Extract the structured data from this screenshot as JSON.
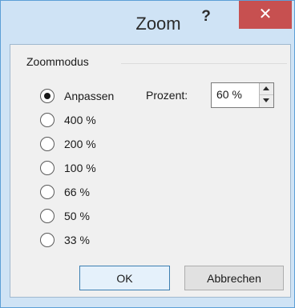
{
  "window": {
    "title": "Zoom",
    "help_label": "?",
    "close_label": "✕"
  },
  "group": {
    "label": "Zoommodus"
  },
  "options": [
    {
      "label": "Anpassen",
      "selected": true
    },
    {
      "label": "400 %",
      "selected": false
    },
    {
      "label": "200 %",
      "selected": false
    },
    {
      "label": "100 %",
      "selected": false
    },
    {
      "label": "66 %",
      "selected": false
    },
    {
      "label": "50 %",
      "selected": false
    },
    {
      "label": "33 %",
      "selected": false
    }
  ],
  "percent": {
    "label": "Prozent:",
    "value": "60 %"
  },
  "buttons": {
    "ok": "OK",
    "cancel": "Abbrechen"
  },
  "colors": {
    "frame": "#cfe3f5",
    "close_button": "#c75050",
    "client": "#f0f0f0"
  }
}
